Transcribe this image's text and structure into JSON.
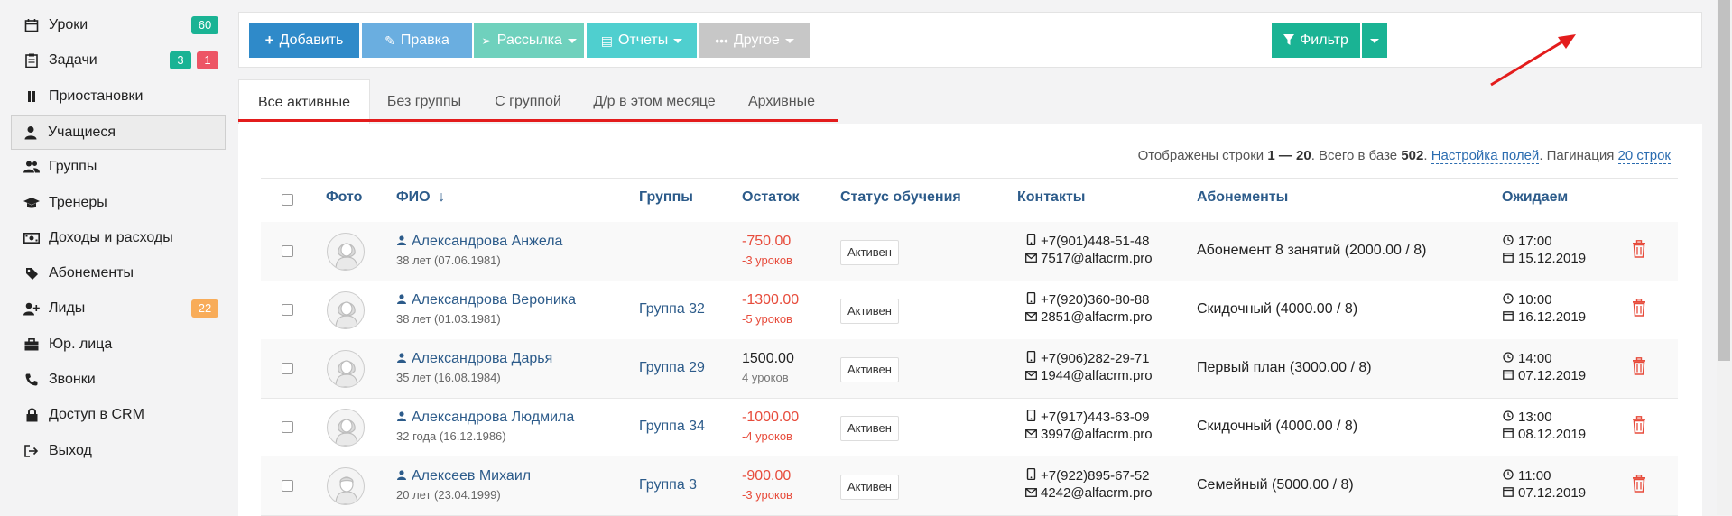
{
  "sidebar": {
    "items": [
      {
        "label": "Уроки",
        "icon": "calendar-icon",
        "badges": [
          {
            "text": "60",
            "color": "#1ab394"
          }
        ]
      },
      {
        "label": "Задачи",
        "icon": "clipboard-icon",
        "badges": [
          {
            "text": "3",
            "color": "#1ab394"
          },
          {
            "text": "1",
            "color": "#ed5565"
          }
        ]
      },
      {
        "label": "Приостановки",
        "icon": "pause-icon",
        "badges": []
      },
      {
        "label": "Учащиеся",
        "icon": "user-icon",
        "badges": [],
        "active": true
      },
      {
        "label": "Группы",
        "icon": "users-icon",
        "badges": []
      },
      {
        "label": "Тренеры",
        "icon": "graduation-cap-icon",
        "badges": []
      },
      {
        "label": "Доходы и расходы",
        "icon": "money-icon",
        "badges": []
      },
      {
        "label": "Абонементы",
        "icon": "tag-icon",
        "badges": []
      },
      {
        "label": "Лиды",
        "icon": "user-plus-icon",
        "badges": [
          {
            "text": "22",
            "color": "#f8ac59"
          }
        ]
      },
      {
        "label": "Юр. лица",
        "icon": "briefcase-icon",
        "badges": []
      },
      {
        "label": "Звонки",
        "icon": "phone-icon",
        "badges": []
      },
      {
        "label": "Доступ в CRM",
        "icon": "lock-icon",
        "badges": []
      },
      {
        "label": "Выход",
        "icon": "sign-out-icon",
        "badges": []
      }
    ]
  },
  "toolbar": {
    "add": "Добавить",
    "edit": "Правка",
    "mailing": "Рассылка",
    "reports": "Отчеты",
    "other": "Другое",
    "filter": "Фильтр"
  },
  "tabs": [
    "Все активные",
    "Без группы",
    "С группой",
    "Д/р в этом месяце",
    "Архивные"
  ],
  "info": {
    "prefix": "Отображены строки ",
    "range": "1 — 20",
    "mid": ". Всего в базе ",
    "total": "502",
    "dot": ". ",
    "fields_link": "Настройка полей",
    "pagination_prefix": ". Пагинация ",
    "pagination_link": "20 строк"
  },
  "columns": [
    "Фото",
    "ФИО",
    "Группы",
    "Остаток",
    "Статус обучения",
    "Контакты",
    "Абонементы",
    "Ожидаем"
  ],
  "sort_arrow": "↓",
  "rows": [
    {
      "name": "Александрова Анжела",
      "age": "38 лет (07.06.1981)",
      "group": "",
      "balance": "-750.00",
      "lessons": "-3 уроков",
      "negative": true,
      "status": "Активен",
      "phone": "+7(901)448-51-48",
      "email": "7517@alfacrm.pro",
      "subscription": "Абонемент 8 занятий (2000.00 / 8)",
      "time": "17:00",
      "date": "15.12.2019",
      "gender": "female"
    },
    {
      "name": "Александрова Вероника",
      "age": "38 лет (01.03.1981)",
      "group": "Группа 32",
      "balance": "-1300.00",
      "lessons": "-5 уроков",
      "negative": true,
      "status": "Активен",
      "phone": "+7(920)360-80-88",
      "email": "2851@alfacrm.pro",
      "subscription": "Скидочный (4000.00 / 8)",
      "time": "10:00",
      "date": "16.12.2019",
      "gender": "female"
    },
    {
      "name": "Александрова Дарья",
      "age": "35 лет (16.08.1984)",
      "group": "Группа 29",
      "balance": "1500.00",
      "lessons": "4 уроков",
      "negative": false,
      "status": "Активен",
      "phone": "+7(906)282-29-71",
      "email": "1944@alfacrm.pro",
      "subscription": "Первый план (3000.00 / 8)",
      "time": "14:00",
      "date": "07.12.2019",
      "gender": "female"
    },
    {
      "name": "Александрова Людмила",
      "age": "32 года (16.12.1986)",
      "group": "Группа 34",
      "balance": "-1000.00",
      "lessons": "-4 уроков",
      "negative": true,
      "status": "Активен",
      "phone": "+7(917)443-63-09",
      "email": "3997@alfacrm.pro",
      "subscription": "Скидочный (4000.00 / 8)",
      "time": "13:00",
      "date": "08.12.2019",
      "gender": "female"
    },
    {
      "name": "Алексеев Михаил",
      "age": "20 лет (23.04.1999)",
      "group": "Группа 3",
      "balance": "-900.00",
      "lessons": "-3 уроков",
      "negative": true,
      "status": "Активен",
      "phone": "+7(922)895-67-52",
      "email": "4242@alfacrm.pro",
      "subscription": "Семейный (5000.00 / 8)",
      "time": "11:00",
      "date": "07.12.2019",
      "gender": "male"
    }
  ],
  "colors": {
    "add": "#2f8ac9",
    "edit": "#6aaee0",
    "mailing": "#6fd1bd",
    "reports": "#4fcfcf",
    "other": "#c7c7c7",
    "filter": "#1ab394",
    "link": "#2c5b8a",
    "danger": "#e74c3c",
    "annotation": "#e31c1c"
  }
}
